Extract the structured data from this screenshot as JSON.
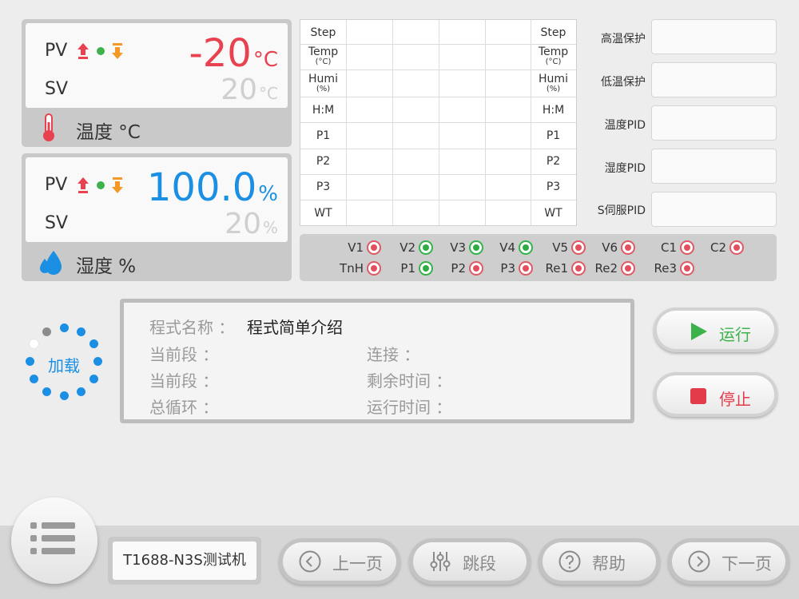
{
  "temperature": {
    "pv_label": "PV",
    "sv_label": "SV",
    "pv_value": "-20",
    "pv_unit": "°C",
    "sv_value": "20",
    "sv_unit": "°C",
    "title": "温度 °C",
    "pv_color": "#e8414f"
  },
  "humidity": {
    "pv_label": "PV",
    "sv_label": "SV",
    "pv_value": "100.0",
    "pv_unit": "%",
    "sv_value": "20",
    "sv_unit": "%",
    "title": "湿度 %",
    "pv_color": "#1a8fe3"
  },
  "program_table": {
    "row_labels": [
      {
        "main": "Step",
        "sub": ""
      },
      {
        "main": "Temp",
        "sub": "(°C)"
      },
      {
        "main": "Humi",
        "sub": "(%)"
      },
      {
        "main": "H:M",
        "sub": ""
      },
      {
        "main": "P1",
        "sub": ""
      },
      {
        "main": "P2",
        "sub": ""
      },
      {
        "main": "P3",
        "sub": ""
      },
      {
        "main": "WT",
        "sub": ""
      }
    ]
  },
  "parameters": [
    {
      "label": "高温保护",
      "value": ""
    },
    {
      "label": "低温保护",
      "value": ""
    },
    {
      "label": "温度PID",
      "value": ""
    },
    {
      "label": "湿度PID",
      "value": ""
    },
    {
      "label": "S伺服PID",
      "value": ""
    }
  ],
  "io_status": {
    "row1": [
      {
        "label": "V1",
        "state": "off"
      },
      {
        "label": "V2",
        "state": "on"
      },
      {
        "label": "V3",
        "state": "on"
      },
      {
        "label": "V4",
        "state": "on"
      },
      {
        "label": "V5",
        "state": "off"
      },
      {
        "label": "V6",
        "state": "off"
      },
      {
        "label": "C1",
        "state": "off"
      },
      {
        "label": "C2",
        "state": "off"
      }
    ],
    "row2": [
      {
        "label": "TnH",
        "state": "off"
      },
      {
        "label": "P1",
        "state": "on"
      },
      {
        "label": "P2",
        "state": "off"
      },
      {
        "label": "P3",
        "state": "off"
      },
      {
        "label": "Re1",
        "state": "off"
      },
      {
        "label": "Re2",
        "state": "off"
      },
      {
        "label": "Re3",
        "state": "off"
      }
    ],
    "on_color": "#2faa44",
    "off_color": "#e0505e"
  },
  "loading": {
    "label": "加载"
  },
  "program_info": {
    "name_label": "程式名称 ：",
    "name_value": "程式简单介绍",
    "segment_label_1": "当前段 ：",
    "segment_label_2": "当前段 ：",
    "cycle_label": "总循环 ：",
    "link_label": "连接 ：",
    "remaining_label": "剩余时间 ：",
    "runtime_label": "运行时间 ："
  },
  "actions": {
    "run_label": "运行",
    "stop_label": "停止",
    "run_color": "#3cb34a",
    "stop_color": "#e33b4a"
  },
  "bottom": {
    "model": "T1688-N3S测试机",
    "prev_label": "上一页",
    "jump_label": "跳段",
    "help_label": "帮助",
    "next_label": "下一页"
  }
}
